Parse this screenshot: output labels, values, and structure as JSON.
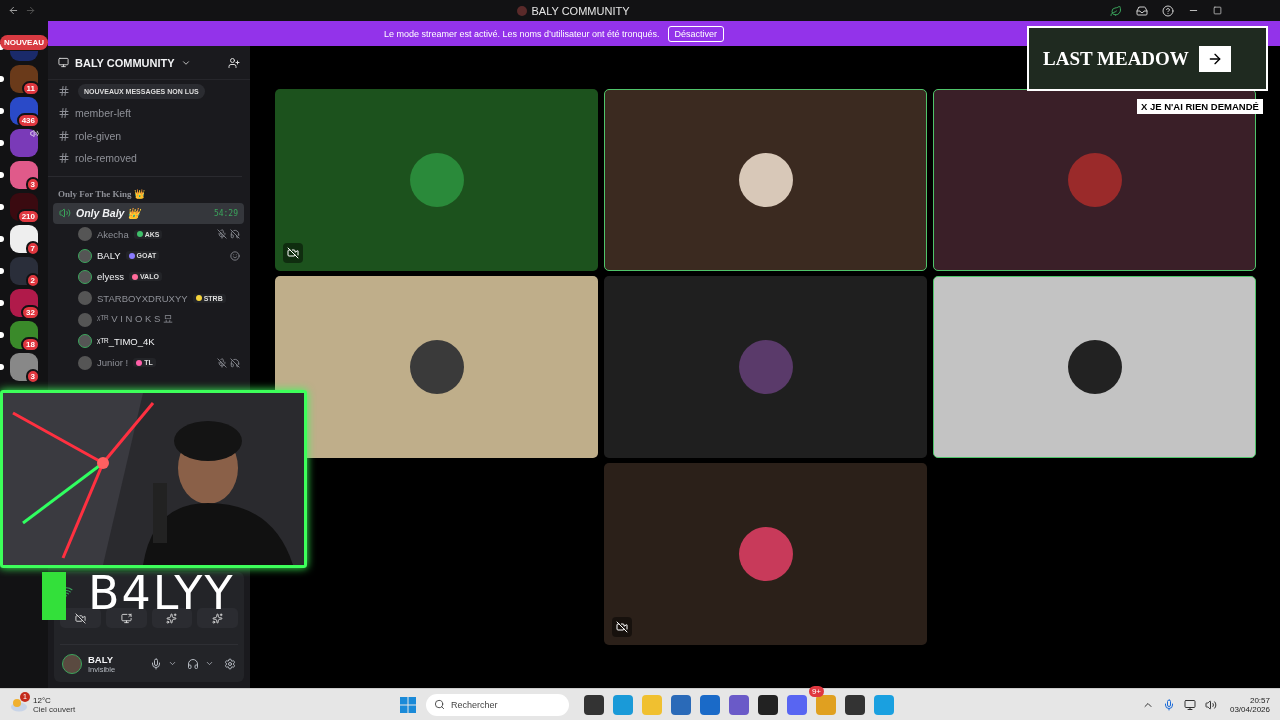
{
  "titlebar": {
    "title": "BALY COMMUNITY"
  },
  "banner": {
    "message": "Le mode streamer est activé. Les noms d’utilisateur ont été tronqués.",
    "button": "Désactiver"
  },
  "servers": [
    {
      "badge": "NOUVEAU",
      "kind": "new",
      "unread": true
    },
    {
      "badge": "11",
      "kind": "count",
      "unread": true
    },
    {
      "badge": "436",
      "kind": "count",
      "unread": true
    },
    {
      "kind": "voice",
      "unread": true
    },
    {
      "badge": "3",
      "kind": "count",
      "unread": true
    },
    {
      "badge": "210",
      "kind": "count",
      "unread": true
    },
    {
      "badge": "7",
      "kind": "count",
      "unread": true
    },
    {
      "badge": "2",
      "kind": "count",
      "unread": true
    },
    {
      "badge": "32",
      "kind": "count",
      "unread": true
    },
    {
      "badge": "18",
      "kind": "count",
      "unread": true
    },
    {
      "badge": "3",
      "kind": "count",
      "unread": true
    }
  ],
  "sidebar": {
    "server_name": "BALY COMMUNITY",
    "unread_pill": "NOUVEAUX MESSAGES NON LUS",
    "text_channels": [
      {
        "name": "member-left"
      },
      {
        "name": "role-given"
      },
      {
        "name": "role-removed"
      }
    ],
    "category": "Only For The King 👑",
    "voice_channel": {
      "name": "Only Baly 👑",
      "timer": "54:29",
      "selected": true
    },
    "members": [
      {
        "name": "Akecha",
        "tag": {
          "label": "AKS",
          "color": "#3fbf6a"
        },
        "speaking": false,
        "muted": true,
        "deafened": true,
        "activity": false
      },
      {
        "name": "BALY",
        "tag": {
          "label": "GOAT",
          "color": "#8a7bff"
        },
        "speaking": true,
        "muted": false,
        "deafened": false,
        "activity": true
      },
      {
        "name": "elyess",
        "tag": {
          "label": "VALO",
          "color": "#ff6b9a"
        },
        "speaking": true,
        "muted": false,
        "deafened": false,
        "activity": false
      },
      {
        "name": "STARBOYXDRUXYY",
        "tag": {
          "label": "STRB",
          "color": "#f5d33b"
        },
        "speaking": false,
        "muted": false,
        "deafened": false,
        "activity": false
      },
      {
        "name": "ᵡᵀᴿ V I N O K S 묘",
        "speaking": false,
        "muted": false,
        "deafened": false,
        "activity": false
      },
      {
        "name": "ᵡᵀᴿ_TIMO_4K",
        "speaking": true,
        "muted": false,
        "deafened": false,
        "activity": false
      },
      {
        "name": "Junior !",
        "tag": {
          "label": "TL",
          "color": "#ff5fa8"
        },
        "speaking": false,
        "muted": true,
        "deafened": true,
        "activity": false
      }
    ],
    "user": {
      "name": "BALY",
      "status": "Invisible"
    }
  },
  "tiles": [
    {
      "color": "#1c521d",
      "speaking": false,
      "video_off": true
    },
    {
      "color": "#3b2a20",
      "speaking": true,
      "video_off": false
    },
    {
      "color": "#3a1f28",
      "speaking": true,
      "video_off": false
    },
    {
      "color": "#bfae8a",
      "speaking": false,
      "video_off": false
    },
    {
      "color": "#1f1f1f",
      "speaking": false,
      "video_off": false
    },
    {
      "color": "#c3c3c3",
      "speaking": true,
      "video_off": false
    },
    {
      "color": "#2b2019",
      "speaking": false,
      "video_off": true
    }
  ],
  "overlay": {
    "stream_name": "B4LYY",
    "ad_title": "LAST MEADOW",
    "ad_dismiss": "X JE N'AI RIEN DEMANDÉ"
  },
  "taskbar": {
    "temperature": "12°C",
    "weather": "Ciel couvert",
    "weather_badge": "1",
    "search_placeholder": "Rechercher",
    "discord_badge": "9+",
    "time": "20:57",
    "date": "03/04/2026"
  }
}
